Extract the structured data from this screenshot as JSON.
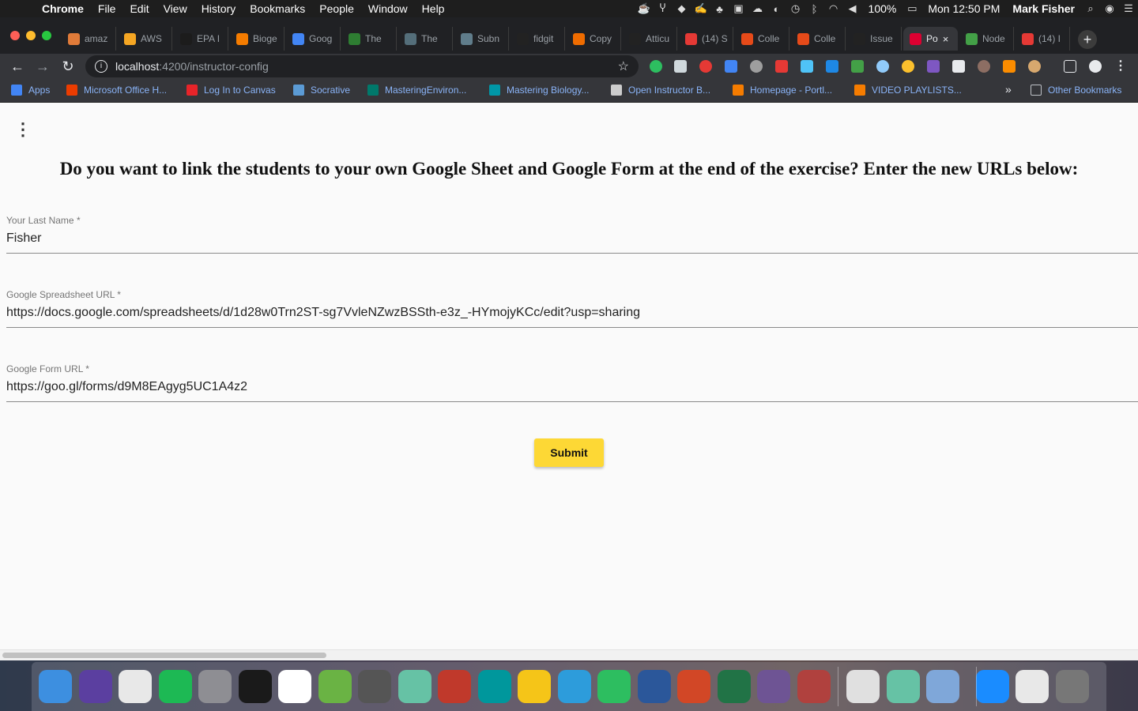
{
  "menubar": {
    "app": "Chrome",
    "items": [
      "File",
      "Edit",
      "View",
      "History",
      "Bookmarks",
      "People",
      "Window",
      "Help"
    ],
    "battery": "100%",
    "clock": "Mon 12:50 PM",
    "user": "Mark Fisher"
  },
  "tabs": [
    {
      "label": "amaz",
      "color": "#e07b39"
    },
    {
      "label": "AWS",
      "color": "#f5a623"
    },
    {
      "label": "EPA I",
      "color": "#1c1c1c"
    },
    {
      "label": "Bioge",
      "color": "#f57c00"
    },
    {
      "label": "Goog",
      "color": "#4285f4"
    },
    {
      "label": "The",
      "color": "#2e7d32"
    },
    {
      "label": "The",
      "color": "#546e7a"
    },
    {
      "label": "Subn",
      "color": "#607d8b"
    },
    {
      "label": "fidgit",
      "color": "#222222"
    },
    {
      "label": "Copy",
      "color": "#ef6c00"
    },
    {
      "label": "Atticu",
      "color": "#222222"
    },
    {
      "label": "(14) S",
      "color": "#e53935"
    },
    {
      "label": "Colle",
      "color": "#e64a19"
    },
    {
      "label": "Colle",
      "color": "#e64a19"
    },
    {
      "label": "Issue",
      "color": "#222222"
    },
    {
      "label": "Po",
      "color": "#dd0031",
      "active": true
    },
    {
      "label": "Node",
      "color": "#43a047"
    },
    {
      "label": "(14) I",
      "color": "#e53935"
    }
  ],
  "address": {
    "host": "localhost",
    "path": ":4200/instructor-config"
  },
  "bookmarks": [
    {
      "label": "Apps",
      "color": "#4285f4"
    },
    {
      "label": "Microsoft Office H...",
      "color": "#eb3c00"
    },
    {
      "label": "Log In to Canvas",
      "color": "#e72429"
    },
    {
      "label": "Socrative",
      "color": "#5b9bd5"
    },
    {
      "label": "MasteringEnviron...",
      "color": "#00796b"
    },
    {
      "label": "Mastering Biology...",
      "color": "#0097a7"
    },
    {
      "label": "Open Instructor B...",
      "color": "#cccccc"
    },
    {
      "label": "Homepage - Portl...",
      "color": "#f57c00"
    },
    {
      "label": "VIDEO PLAYLISTS...",
      "color": "#f57c00"
    }
  ],
  "other_bookmarks": "Other Bookmarks",
  "chevron": "»",
  "page": {
    "heading": "Do you want to link the students to your own Google Sheet and Google Form at the end of the exercise? Enter the new URLs below:",
    "fields": [
      {
        "label": "Your Last Name *",
        "value": "Fisher"
      },
      {
        "label": "Google Spreadsheet URL *",
        "value": "https://docs.google.com/spreadsheets/d/1d28w0Trn2ST-sg7VvleNZwzBSSth-e3z_-HYmojyKCc/edit?usp=sharing"
      },
      {
        "label": "Google Form URL *",
        "value": "https://goo.gl/forms/d9M8EAgyg5UC1A4z2"
      }
    ],
    "submit_label": "Submit"
  },
  "dock_icons": [
    {
      "name": "finder",
      "color": "#3d8fe0"
    },
    {
      "name": "siri",
      "color": "#5b3fa0"
    },
    {
      "name": "chrome",
      "color": "#e8e8e8"
    },
    {
      "name": "spotify",
      "color": "#1db954"
    },
    {
      "name": "system-preferences",
      "color": "#8e8e93"
    },
    {
      "name": "terminal",
      "color": "#1a1a1a"
    },
    {
      "name": "slack",
      "color": "#ffffff"
    },
    {
      "name": "android-studio",
      "color": "#6ab344"
    },
    {
      "name": "help",
      "color": "#555555"
    },
    {
      "name": "atom",
      "color": "#66c2a5"
    },
    {
      "name": "rstudio",
      "color": "#c0392b"
    },
    {
      "name": "arduino",
      "color": "#00979c"
    },
    {
      "name": "cyberduck",
      "color": "#f5c518"
    },
    {
      "name": "markdown",
      "color": "#2d9cdb"
    },
    {
      "name": "evernote",
      "color": "#2dbe60"
    },
    {
      "name": "word",
      "color": "#2b579a"
    },
    {
      "name": "powerpoint",
      "color": "#d24726"
    },
    {
      "name": "excel",
      "color": "#217346"
    },
    {
      "name": "github-cat",
      "color": "#6e5494"
    },
    {
      "name": "photo-booth",
      "color": "#b0413e"
    },
    {
      "name": "script-editor",
      "color": "#e0e0e0"
    },
    {
      "name": "atom-2",
      "color": "#66c2a5"
    },
    {
      "name": "preview",
      "color": "#7fa7d9"
    },
    {
      "name": "1password",
      "color": "#1a8cff"
    },
    {
      "name": "chrome-window",
      "color": "#e8e8e8"
    },
    {
      "name": "trash",
      "color": "#777777"
    }
  ]
}
